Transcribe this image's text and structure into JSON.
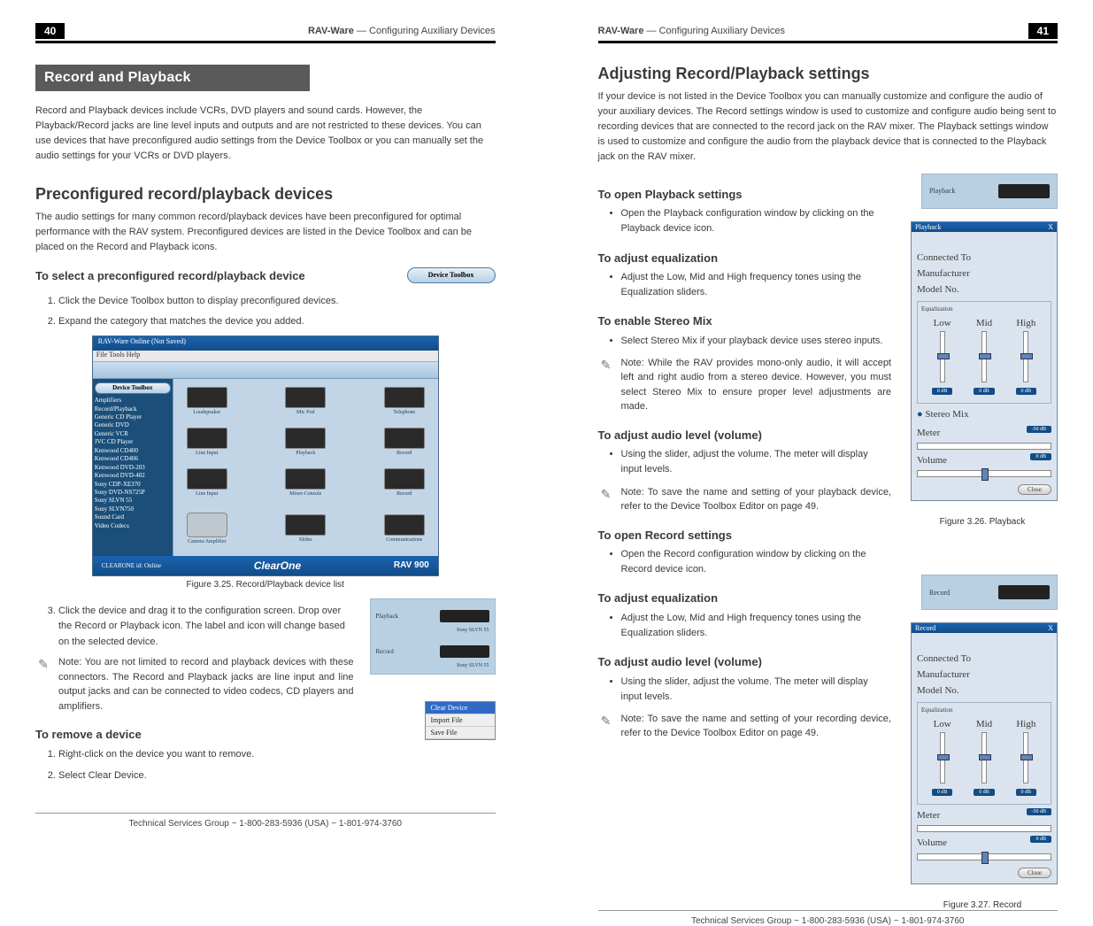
{
  "header": {
    "product": "RAV-Ware",
    "section": "Configuring Auxiliary Devices",
    "page_left": "40",
    "page_right": "41"
  },
  "footer": "Technical Services Group ~ 1-800-283-5936 (USA) ~ 1-801-974-3760",
  "left": {
    "section_title": "Record and Playback",
    "intro": "Record and Playback devices include VCRs, DVD players and sound cards. However, the Playback/Record jacks are line level inputs and outputs and are not restricted to these devices. You can use devices that have preconfigured audio settings from the Device Toolbox or you can manually set the audio settings for your VCRs or DVD players.",
    "h2_preconfig": "Preconfigured record/playback devices",
    "preconfig_body": "The audio settings for many common record/playback devices have been preconfigured for optimal performance with the RAV system. Preconfigured devices are listed in the Device Toolbox and can be placed on the Record and Playback icons.",
    "h3_select": "To select a preconfigured record/playback device",
    "steps_select": [
      "Click the Device Toolbox button to display preconfigured devices.",
      "Expand the category that matches the device you added."
    ],
    "toolbox_btn_label": "Device Toolbox",
    "fig325_caption": "Figure 3.25. Record/Playback device list",
    "step3": "Click the device and drag it to the configuration screen. Drop over the Record or Playback icon. The label and icon will change based on the selected device.",
    "note1": "Note: You are not limited to record and playback devices with these connectors. The Record and Playback jacks are line input and line output jacks and can be connected to video codecs, CD players and amplifiers.",
    "h3_remove": "To remove a device",
    "steps_remove": [
      "Right-click on the device you want to remove.",
      "Select Clear Device."
    ],
    "pb_labels": {
      "playback": "Playback",
      "record": "Record",
      "device_caption": "Sony SLVN 55"
    },
    "ctx_menu": [
      "Clear Device",
      "Import File",
      "Save File"
    ],
    "app": {
      "title": "RAV-Ware   Online   (Not Saved)",
      "menus": "File   Tools   Help",
      "tree_header": "Device Toolbox",
      "tree_items": [
        "Amplifiers",
        "Record/Playback",
        "  Generic   CD Player",
        "  Generic   DVD",
        "  Generic   VCR",
        "  JVC   CD Player",
        "  Kenwood   CD400",
        "  Kenwood   CD406",
        "  Kenwood   DVD-203",
        "  Kenwood   DVD-402",
        "  Sony   CDP-XE370",
        "  Sony   DVD-NS725P",
        "  Sony   SLVN 55",
        "  Sony   SLVN750",
        "Sound Card",
        "Video Codecs"
      ],
      "rows": [
        [
          "Loudspeaker",
          "Mic Pod",
          "Telephone"
        ],
        [
          "Line Input",
          "Playback",
          "Record"
        ],
        [
          "Line Input",
          "Mixer-Console",
          "Record"
        ],
        [
          "Camera Amplifier",
          "Slides",
          "Communications"
        ]
      ],
      "status_left": "CLEARONE id: Online",
      "brand": "ClearOne",
      "model": "RAV 900"
    }
  },
  "right": {
    "h2": "Adjusting Record/Playback settings",
    "intro": "If your device is not listed in the Device Toolbox you can manually customize and configure the audio of your auxiliary devices. The Record settings window is used to customize and configure audio being sent to recording devices that are connected to the record jack on the RAV mixer. The Playback settings window is used to customize and configure the audio from the playback device that is connected to the Playback jack on the RAV mixer.",
    "items": {
      "open_playback_h": "To open Playback settings",
      "open_playback_b": "Open the Playback configuration window by clicking on the Playback device icon.",
      "eq1_h": "To adjust equalization",
      "eq1_b": "Adjust the Low, Mid and High frequency tones using the Equalization sliders.",
      "stereo_h": "To enable Stereo Mix",
      "stereo_b": "Select Stereo Mix if your playback device uses stereo inputs.",
      "stereo_note": "Note: While the RAV provides mono-only audio, it will accept left and right audio from a stereo device. However, you must select Stereo Mix to ensure proper level adjustments are made.",
      "vol1_h": "To adjust audio level (volume)",
      "vol1_b": "Using the slider, adjust the volume. The meter will display input levels.",
      "vol1_note": "Note: To save the name and setting of your playback device, refer to the Device Toolbox Editor on page 49.",
      "open_record_h": "To open Record settings",
      "open_record_b": "Open the Record configuration window by clicking on the Record device icon.",
      "eq2_h": "To adjust equalization",
      "eq2_b": "Adjust the Low, Mid and High frequency tones using the Equalization sliders.",
      "vol2_h": "To adjust audio level (volume)",
      "vol2_b": "Using the slider, adjust the volume. The meter will display input levels.",
      "vol2_note": "Note: To save the name and setting of your recording device, refer to the Device Toolbox Editor on page 49."
    },
    "fig326_caption": "Figure 3.26. Playback",
    "fig327_caption": "Figure 3.27. Record",
    "strip_playback": "Playback",
    "strip_record": "Record",
    "dlg": {
      "title_playback": "Playback",
      "title_record": "Record",
      "connected_to": "Connected To",
      "manufacturer": "Manufacturer",
      "model_no": "Model No.",
      "equalization": "Equalization",
      "low": "Low",
      "mid": "Mid",
      "high": "High",
      "zero_db": "0 dB",
      "stereo_mix": "Stereo Mix",
      "meter": "Meter",
      "meter_val": "-50 dB",
      "volume": "Volume",
      "vol_val": "0 dB",
      "close": "Close",
      "x": "X"
    }
  }
}
